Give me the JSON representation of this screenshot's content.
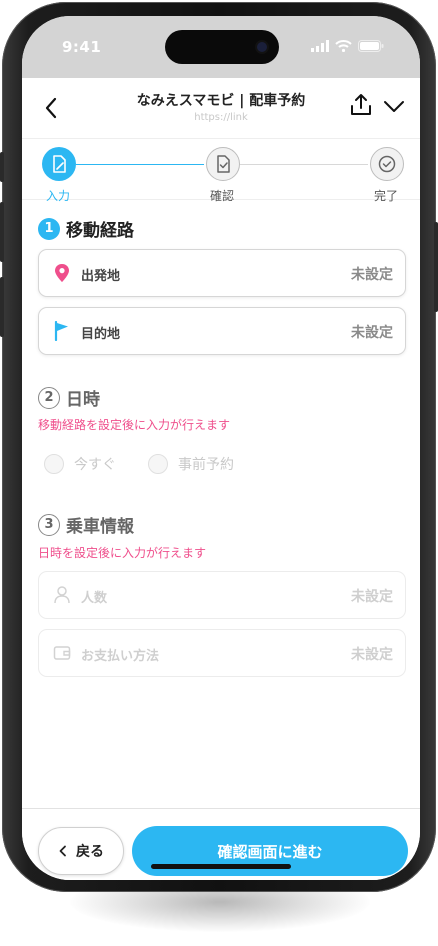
{
  "status_bar": {
    "time": "9:41"
  },
  "app_bar": {
    "title": "なみえスマモビ | 配車予約",
    "url": "https://link"
  },
  "stepper": {
    "steps": [
      {
        "label": "入力",
        "state": "active"
      },
      {
        "label": "確認",
        "state": "pending"
      },
      {
        "label": "完了",
        "state": "pending"
      }
    ]
  },
  "route_section": {
    "number": "1",
    "title": "移動経路",
    "fields": [
      {
        "label": "出発地",
        "value": "未設定",
        "icon": "map-pin-icon"
      },
      {
        "label": "目的地",
        "value": "未設定",
        "icon": "flag-icon"
      }
    ]
  },
  "datetime_section": {
    "number": "2",
    "title": "日時",
    "hint": "移動経路を設定後に入力が行えます",
    "options": [
      {
        "label": "今すぐ"
      },
      {
        "label": "事前予約"
      }
    ]
  },
  "ride_section": {
    "number": "3",
    "title": "乗車情報",
    "hint": "日時を設定後に入力が行えます",
    "fields": [
      {
        "label": "人数",
        "value": "未設定",
        "icon": "person-icon"
      },
      {
        "label": "お支払い方法",
        "value": "未設定",
        "icon": "wallet-icon"
      }
    ]
  },
  "footer": {
    "back_label": "戻る",
    "next_label": "確認画面に進む"
  },
  "colors": {
    "accent": "#2cb7f2",
    "hint": "#ef4f8c",
    "pin": "#ef4f8c",
    "flag": "#2cb7f2"
  }
}
